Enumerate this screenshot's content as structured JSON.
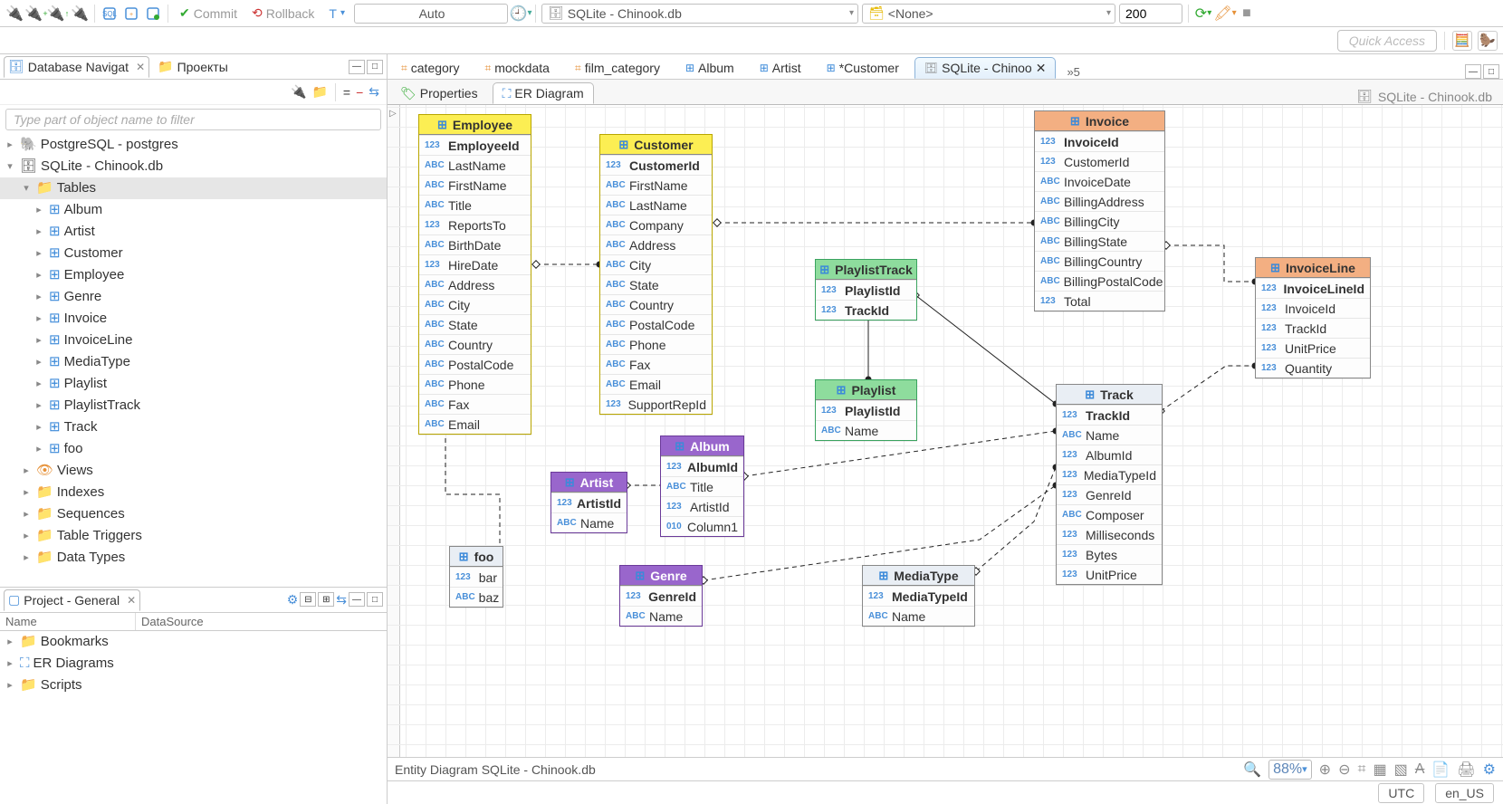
{
  "toolbar": {
    "commit_label": "Commit",
    "rollback_label": "Rollback",
    "txn_mode": "Auto",
    "datasource": "SQLite - Chinook.db",
    "schema": "<None>",
    "limit": "200"
  },
  "quick_access": "Quick Access",
  "left": {
    "nav_tab": "Database Navigat",
    "projects_tab": "Проекты",
    "filter_placeholder": "Type part of object name to filter",
    "conn1": "PostgreSQL - postgres",
    "conn2": "SQLite - Chinook.db",
    "tables_folder": "Tables",
    "tables": [
      "Album",
      "Artist",
      "Customer",
      "Employee",
      "Genre",
      "Invoice",
      "InvoiceLine",
      "MediaType",
      "Playlist",
      "PlaylistTrack",
      "Track",
      "foo"
    ],
    "views": "Views",
    "indexes": "Indexes",
    "sequences": "Sequences",
    "table_triggers": "Table Triggers",
    "data_types": "Data Types"
  },
  "project": {
    "title": "Project - General",
    "col_name": "Name",
    "col_ds": "DataSource",
    "bookmarks": "Bookmarks",
    "erdiagrams": "ER Diagrams",
    "scripts": "Scripts"
  },
  "editor_tabs": {
    "t0": "category",
    "t1": "mockdata",
    "t2": "film_category",
    "t3": "Album",
    "t4": "Artist",
    "t5": "*Customer",
    "t6": "SQLite - Chinoo",
    "more": "»5"
  },
  "sub": {
    "properties": "Properties",
    "erdiagram": "ER Diagram",
    "breadcrumb": "SQLite - Chinook.db"
  },
  "entities": {
    "Employee": {
      "hdr": "Employee",
      "cols": [
        {
          "t": "123",
          "n": "EmployeeId",
          "pk": true
        },
        {
          "t": "ABC",
          "n": "LastName"
        },
        {
          "t": "ABC",
          "n": "FirstName"
        },
        {
          "t": "ABC",
          "n": "Title"
        },
        {
          "t": "123",
          "n": "ReportsTo"
        },
        {
          "t": "ABC",
          "n": "BirthDate"
        },
        {
          "t": "123",
          "n": "HireDate"
        },
        {
          "t": "ABC",
          "n": "Address"
        },
        {
          "t": "ABC",
          "n": "City"
        },
        {
          "t": "ABC",
          "n": "State"
        },
        {
          "t": "ABC",
          "n": "Country"
        },
        {
          "t": "ABC",
          "n": "PostalCode"
        },
        {
          "t": "ABC",
          "n": "Phone"
        },
        {
          "t": "ABC",
          "n": "Fax"
        },
        {
          "t": "ABC",
          "n": "Email"
        }
      ]
    },
    "Customer": {
      "hdr": "Customer",
      "cols": [
        {
          "t": "123",
          "n": "CustomerId",
          "pk": true
        },
        {
          "t": "ABC",
          "n": "FirstName"
        },
        {
          "t": "ABC",
          "n": "LastName"
        },
        {
          "t": "ABC",
          "n": "Company"
        },
        {
          "t": "ABC",
          "n": "Address"
        },
        {
          "t": "ABC",
          "n": "City"
        },
        {
          "t": "ABC",
          "n": "State"
        },
        {
          "t": "ABC",
          "n": "Country"
        },
        {
          "t": "ABC",
          "n": "PostalCode"
        },
        {
          "t": "ABC",
          "n": "Phone"
        },
        {
          "t": "ABC",
          "n": "Fax"
        },
        {
          "t": "ABC",
          "n": "Email"
        },
        {
          "t": "123",
          "n": "SupportRepId"
        }
      ]
    },
    "Invoice": {
      "hdr": "Invoice",
      "cols": [
        {
          "t": "123",
          "n": "InvoiceId",
          "pk": true
        },
        {
          "t": "123",
          "n": "CustomerId"
        },
        {
          "t": "ABC",
          "n": "InvoiceDate"
        },
        {
          "t": "ABC",
          "n": "BillingAddress"
        },
        {
          "t": "ABC",
          "n": "BillingCity"
        },
        {
          "t": "ABC",
          "n": "BillingState"
        },
        {
          "t": "ABC",
          "n": "BillingCountry"
        },
        {
          "t": "ABC",
          "n": "BillingPostalCode"
        },
        {
          "t": "123",
          "n": "Total"
        }
      ]
    },
    "InvoiceLine": {
      "hdr": "InvoiceLine",
      "cols": [
        {
          "t": "123",
          "n": "InvoiceLineId",
          "pk": true
        },
        {
          "t": "123",
          "n": "InvoiceId"
        },
        {
          "t": "123",
          "n": "TrackId"
        },
        {
          "t": "123",
          "n": "UnitPrice"
        },
        {
          "t": "123",
          "n": "Quantity"
        }
      ]
    },
    "PlaylistTrack": {
      "hdr": "PlaylistTrack",
      "cols": [
        {
          "t": "123",
          "n": "PlaylistId",
          "pk": true
        },
        {
          "t": "123",
          "n": "TrackId",
          "pk": true
        }
      ]
    },
    "Playlist": {
      "hdr": "Playlist",
      "cols": [
        {
          "t": "123",
          "n": "PlaylistId",
          "pk": true
        },
        {
          "t": "ABC",
          "n": "Name"
        }
      ]
    },
    "Track": {
      "hdr": "Track",
      "cols": [
        {
          "t": "123",
          "n": "TrackId",
          "pk": true
        },
        {
          "t": "ABC",
          "n": "Name"
        },
        {
          "t": "123",
          "n": "AlbumId"
        },
        {
          "t": "123",
          "n": "MediaTypeId"
        },
        {
          "t": "123",
          "n": "GenreId"
        },
        {
          "t": "ABC",
          "n": "Composer"
        },
        {
          "t": "123",
          "n": "Milliseconds"
        },
        {
          "t": "123",
          "n": "Bytes"
        },
        {
          "t": "123",
          "n": "UnitPrice"
        }
      ]
    },
    "Artist": {
      "hdr": "Artist",
      "cols": [
        {
          "t": "123",
          "n": "ArtistId",
          "pk": true
        },
        {
          "t": "ABC",
          "n": "Name"
        }
      ]
    },
    "Album": {
      "hdr": "Album",
      "cols": [
        {
          "t": "123",
          "n": "AlbumId",
          "pk": true
        },
        {
          "t": "ABC",
          "n": "Title"
        },
        {
          "t": "123",
          "n": "ArtistId"
        },
        {
          "t": "010",
          "n": "Column1"
        }
      ]
    },
    "Genre": {
      "hdr": "Genre",
      "cols": [
        {
          "t": "123",
          "n": "GenreId",
          "pk": true
        },
        {
          "t": "ABC",
          "n": "Name"
        }
      ]
    },
    "MediaType": {
      "hdr": "MediaType",
      "cols": [
        {
          "t": "123",
          "n": "MediaTypeId",
          "pk": true
        },
        {
          "t": "ABC",
          "n": "Name"
        }
      ]
    },
    "foo": {
      "hdr": "foo",
      "cols": [
        {
          "t": "123",
          "n": "bar"
        },
        {
          "t": "ABC",
          "n": "baz"
        }
      ]
    }
  },
  "status": {
    "title": "Entity Diagram SQLite - Chinook.db",
    "zoom": "88%"
  },
  "bottom": {
    "tz": "UTC",
    "locale": "en_US"
  }
}
